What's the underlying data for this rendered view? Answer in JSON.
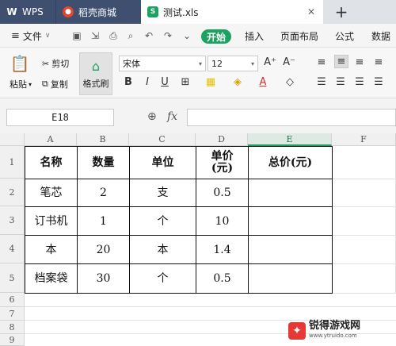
{
  "tabs": {
    "wps": "WPS",
    "daoke": "稻壳商城",
    "file": "测试.xls"
  },
  "menu": {
    "file": "文件",
    "start": "开始",
    "insert": "插入",
    "page_layout": "页面布局",
    "formula": "公式",
    "data": "数据"
  },
  "ribbon": {
    "paste": "粘贴",
    "cut": "剪切",
    "copy": "复制",
    "format_painter": "格式刷",
    "font_name": "宋体",
    "font_size": "12",
    "increase_font": "A⁺",
    "decrease_font": "A⁻",
    "bold": "B",
    "italic": "I",
    "underline": "U"
  },
  "formula_bar": {
    "name_box": "E18",
    "fx": "fx",
    "value": ""
  },
  "columns": [
    "A",
    "B",
    "C",
    "D",
    "E",
    "F"
  ],
  "rows": [
    "1",
    "2",
    "3",
    "4",
    "5",
    "6",
    "7",
    "8",
    "9"
  ],
  "table": {
    "header": [
      "名称",
      "数量",
      "单位",
      "单价\n(元)",
      "总价(元)"
    ],
    "body": [
      [
        "笔芯",
        "2",
        "支",
        "0.5",
        ""
      ],
      [
        "订书机",
        "1",
        "个",
        "10",
        ""
      ],
      [
        "本",
        "20",
        "本",
        "1.4",
        ""
      ],
      [
        "档案袋",
        "30",
        "个",
        "0.5",
        ""
      ]
    ]
  },
  "watermark": {
    "text": "锐得游戏网",
    "url": "www.ytruido.com"
  },
  "colors": {
    "accent": "#1ba261",
    "tab_dark": "#3e4f70"
  }
}
